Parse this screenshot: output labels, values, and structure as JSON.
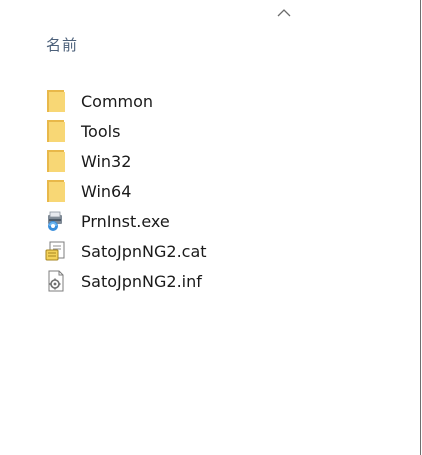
{
  "header": {
    "column_label": "名前",
    "sort_indicator": "ascending"
  },
  "colors": {
    "folder_yellow": "#F8D775",
    "folder_shade": "#E8B84A",
    "header_text": "#4C607A",
    "item_text": "#1A1A1A"
  },
  "items": [
    {
      "name": "Common",
      "icon": "folder-icon"
    },
    {
      "name": "Tools",
      "icon": "folder-icon"
    },
    {
      "name": "Win32",
      "icon": "folder-icon"
    },
    {
      "name": "Win64",
      "icon": "folder-icon"
    },
    {
      "name": "PrnInst.exe",
      "icon": "installer-exe-icon"
    },
    {
      "name": "SatoJpnNG2.cat",
      "icon": "security-catalog-icon"
    },
    {
      "name": "SatoJpnNG2.inf",
      "icon": "setup-information-icon"
    }
  ]
}
